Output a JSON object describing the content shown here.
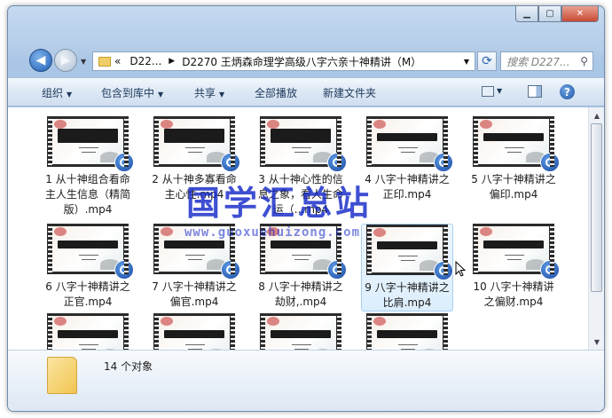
{
  "address": {
    "crumb_prefix": "«",
    "crumb_parent": "D22...",
    "crumb_current": "D2270 王炳森命理学高级八字六亲十神精讲（M）"
  },
  "search": {
    "placeholder": "搜索 D227..."
  },
  "toolbar": {
    "organize": "组织",
    "include_library": "包含到库中",
    "share": "共享",
    "play_all": "全部播放",
    "new_folder": "新建文件夹"
  },
  "files": [
    {
      "label": "1 从十神组合看命主人生信息（精简版）.mp4"
    },
    {
      "label": "2 从十神多寡看命主心性.mp4"
    },
    {
      "label": "3 从十神心性的信息之象，看人生命运（...mp4"
    },
    {
      "label": "4 八字十神精讲之正印.mp4"
    },
    {
      "label": "5 八字十神精讲之偏印.mp4"
    },
    {
      "label": "6 八字十神精讲之正官.mp4"
    },
    {
      "label": "7 八字十神精讲之偏官.mp4"
    },
    {
      "label": "8 八字十神精讲之劫财,.mp4"
    },
    {
      "label": "9 八字十神精讲之比肩.mp4"
    },
    {
      "label": "10 八字十神精讲之偏财.mp4"
    },
    {
      "label": ""
    },
    {
      "label": ""
    },
    {
      "label": ""
    },
    {
      "label": ""
    }
  ],
  "watermark": {
    "text": "国学汇总站",
    "url": "www.guoxuehuizong.com"
  },
  "status": {
    "count_text": "14 个对象"
  },
  "colors": {
    "accent": "#1f5fb8",
    "watermark": "#1428c8",
    "selection": "#dceefc"
  }
}
